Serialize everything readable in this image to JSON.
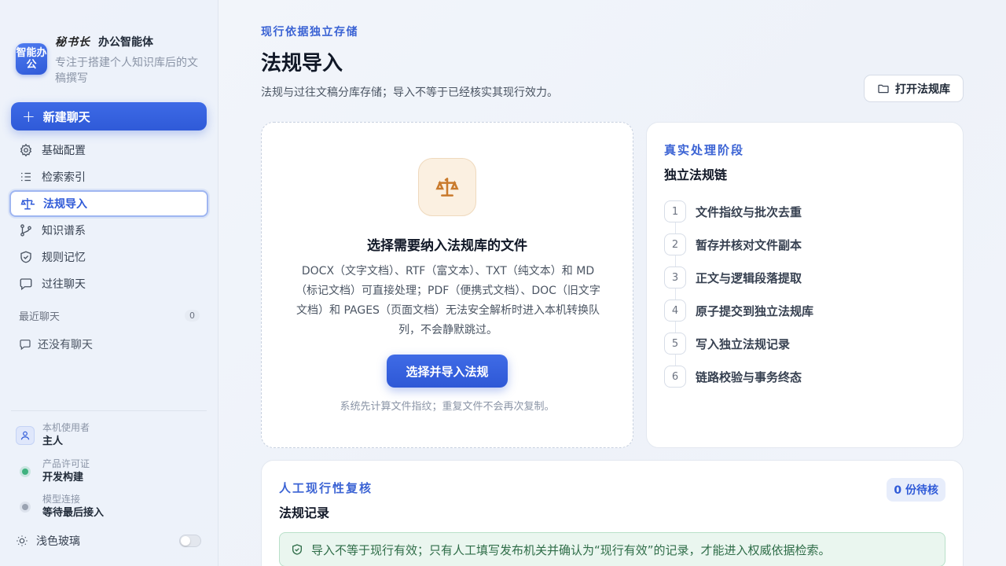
{
  "brand": {
    "logo_text": "智能办公",
    "script_name": "秘书长",
    "title": "办公智能体",
    "description": "专注于搭建个人知识库后的文稿撰写"
  },
  "sidebar": {
    "new_chat_label": "新建聊天",
    "items": [
      {
        "label": "基础配置",
        "icon": "gear-icon"
      },
      {
        "label": "检索索引",
        "icon": "list-icon"
      },
      {
        "label": "法规导入",
        "icon": "scale-icon",
        "active": true
      },
      {
        "label": "知识谱系",
        "icon": "branch-icon"
      },
      {
        "label": "规则记忆",
        "icon": "shield-icon"
      },
      {
        "label": "过往聊天",
        "icon": "chat-icon"
      }
    ],
    "recent_label": "最近聊天",
    "recent_count": "0",
    "recent_empty": "还没有聊天",
    "user_label": "本机使用者",
    "user_value": "主人",
    "license_label": "产品许可证",
    "license_value": "开发构建",
    "model_label": "模型连接",
    "model_value": "等待最后接入",
    "theme_label": "浅色玻璃",
    "theme_enabled": false
  },
  "header": {
    "eyebrow": "现行依据独立存储",
    "title": "法规导入",
    "subtitle": "法规与过往文稿分库存储；导入不等于已经核实其现行效力。",
    "open_library_label": "打开法规库"
  },
  "upload": {
    "title": "选择需要纳入法规库的文件",
    "description": "DOCX（文字文档）、RTF（富文本）、TXT（纯文本）和 MD（标记文档）可直接处理；PDF（便携式文档）、DOC（旧文字文档）和 PAGES（页面文档）无法安全解析时进入本机转换队列，不会静默跳过。",
    "button_label": "选择并导入法规",
    "hint": "系统先计算文件指纹；重复文件不会再次复制。"
  },
  "stages": {
    "eyebrow": "真实处理阶段",
    "title": "独立法规链",
    "steps": [
      {
        "num": "1",
        "label": "文件指纹与批次去重"
      },
      {
        "num": "2",
        "label": "暂存并核对文件副本"
      },
      {
        "num": "3",
        "label": "正文与逻辑段落提取"
      },
      {
        "num": "4",
        "label": "原子提交到独立法规库"
      },
      {
        "num": "5",
        "label": "写入独立法规记录"
      },
      {
        "num": "6",
        "label": "链路校验与事务终态"
      }
    ]
  },
  "review": {
    "eyebrow": "人工现行性复核",
    "title": "法规记录",
    "pending_label": "0 份待核",
    "notice": "导入不等于现行有效；只有人工填写发布机关并确认为“现行有效”的记录，才能进入权威依据检索。"
  },
  "colors": {
    "accent": "#2f5ad8",
    "success": "#2f6d48",
    "license_dot": "#3fb27f",
    "model_dot": "#9aa3b2"
  }
}
